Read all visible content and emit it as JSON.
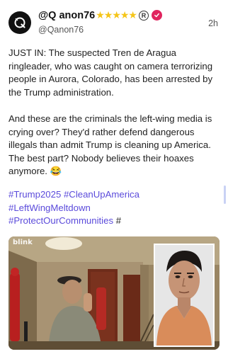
{
  "post": {
    "display_name": "@Q anon76",
    "stars": "★★★★★",
    "registered_mark": "R",
    "handle": "@Qanon76",
    "timestamp": "2h",
    "paragraphs": [
      "JUST IN: The suspected Tren de Aragua ringleader, who was caught on camera terrorizing people in Aurora, Colorado, has been arrested by the Trump administration.",
      "And these are the criminals the left-wing media is crying over? They'd rather defend dangerous illegals than admit Trump is cleaning up America. The best part? Nobody believes their hoaxes anymore. 😂"
    ],
    "hashtags": [
      "#Trump2025",
      "#CleanUpAmerica",
      "#LeftWingMeltdown",
      "#ProtectOurCommunities"
    ],
    "trailing_hash": "#"
  },
  "media": {
    "camera_watermark": "blink"
  },
  "colors": {
    "hashtag": "#5b4bdb",
    "verified_badge": "#e0245e",
    "stars": "#f5c518"
  },
  "icons": {
    "avatar": "q-logo-icon",
    "verified": "verified-check-icon",
    "registered": "registered-icon"
  }
}
